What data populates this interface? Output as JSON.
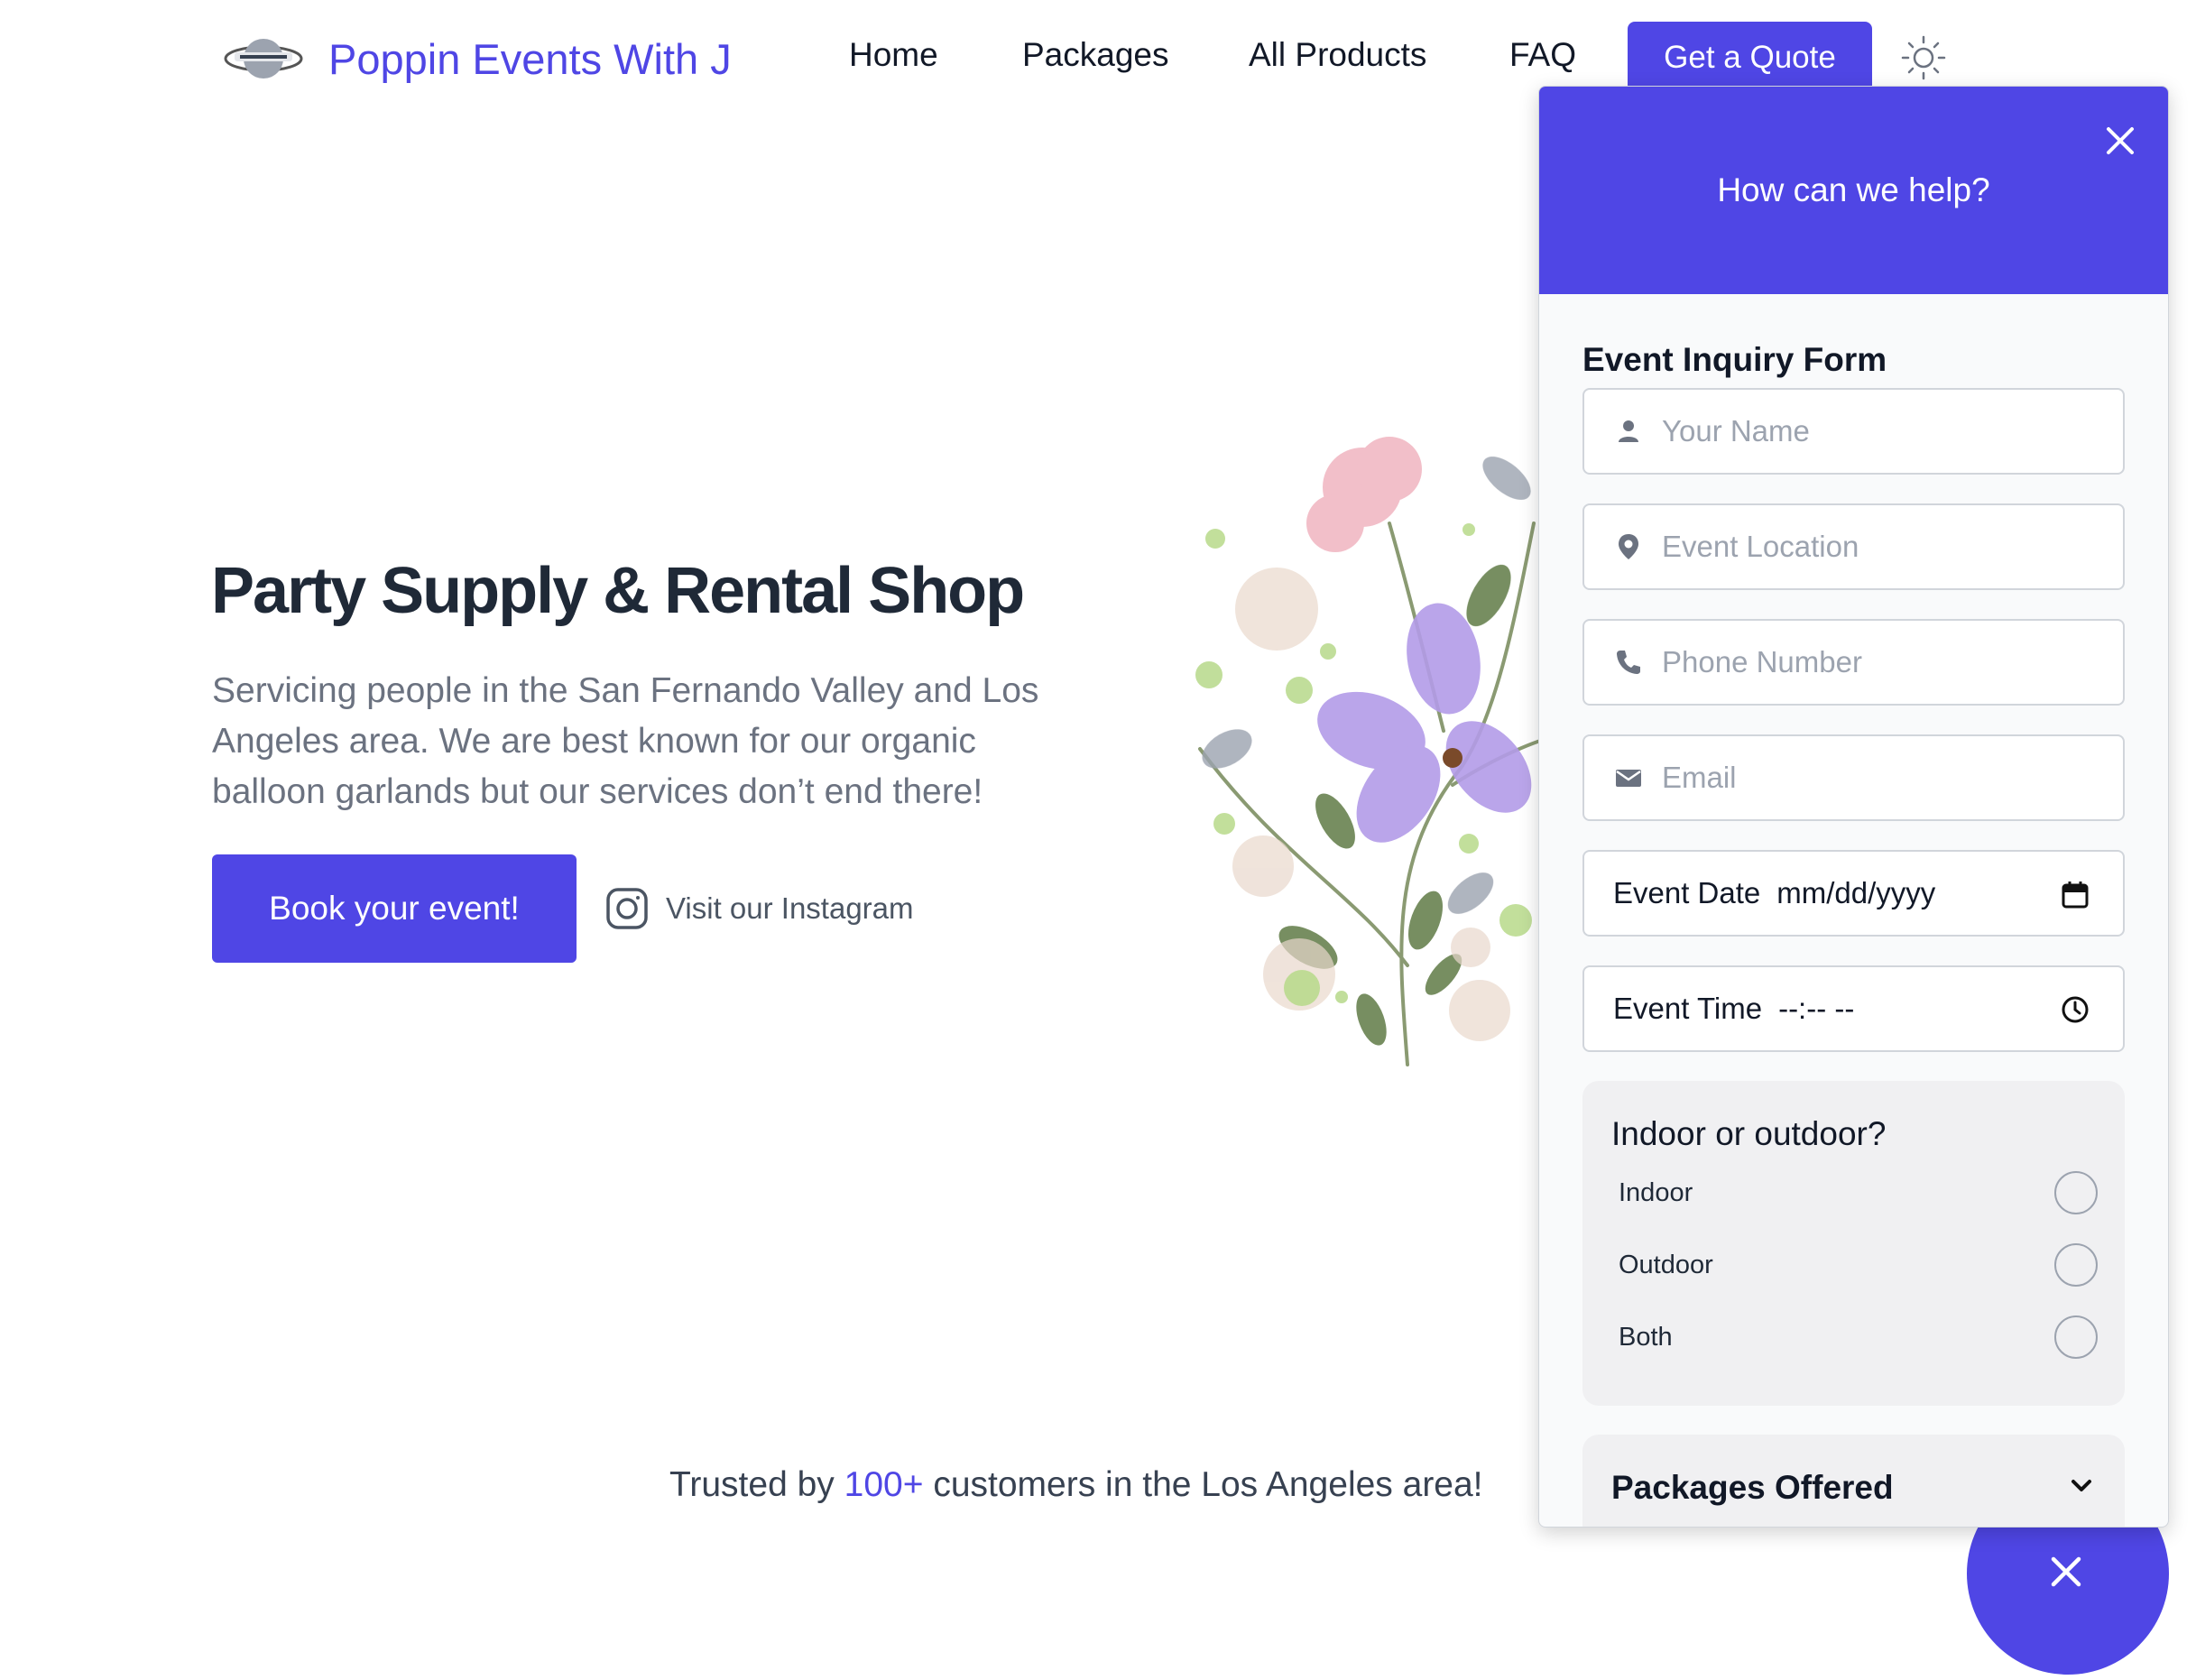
{
  "nav": {
    "brand": "Poppin Events With J",
    "links": [
      "Home",
      "Packages",
      "All Products",
      "FAQ"
    ],
    "quote_button": "Get a Quote",
    "theme_icon": "sun-icon"
  },
  "hero": {
    "title": "Party Supply & Rental Shop",
    "subtitle": "Servicing people in the San Fernando Valley and Los Angeles area. We are best known for our organic balloon garlands but our services don’t end there!",
    "book_button": "Book your event!",
    "instagram_link": "Visit our Instagram"
  },
  "trusted": {
    "prefix": "Trusted by ",
    "highlight": "100+",
    "suffix": " customers in the Los Angeles area!"
  },
  "panel": {
    "heading": "How can we help?",
    "form_title": "Event Inquiry Form",
    "fields": {
      "name_placeholder": "Your Name",
      "location_placeholder": "Event Location",
      "phone_placeholder": "Phone Number",
      "email_placeholder": "Email",
      "date_label": "Event Date",
      "date_value": "mm/dd/yyyy",
      "time_label": "Event Time",
      "time_value": "--:-- --"
    },
    "venue": {
      "title": "Indoor or outdoor?",
      "options": [
        "Indoor",
        "Outdoor",
        "Both"
      ],
      "selected": null
    },
    "packages_title": "Packages Offered"
  },
  "colors": {
    "accent": "#4f46e5",
    "text": "#1f2937",
    "muted": "#6b7280"
  }
}
